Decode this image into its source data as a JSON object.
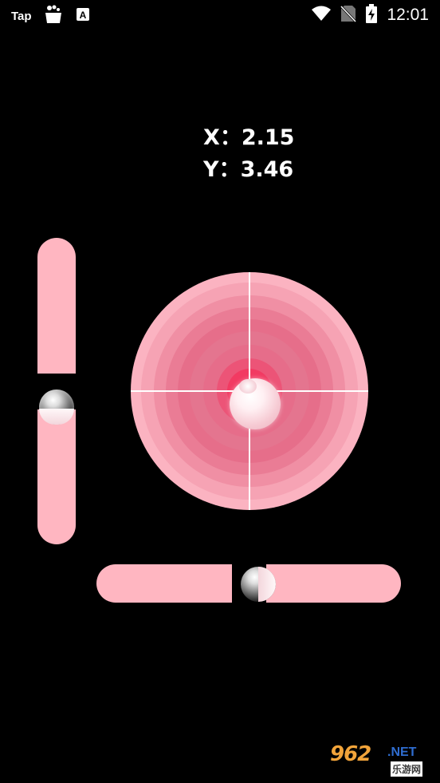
{
  "status_bar": {
    "app_label": "Tap",
    "time": "12:01",
    "icons": [
      "tap-app-icon",
      "bag-icon",
      "a-badge-icon",
      "wifi-icon",
      "no-sim-icon",
      "battery-charging-icon"
    ]
  },
  "readout": {
    "x_label": "X：",
    "x_value": "2.15",
    "y_label": "Y：",
    "y_value": "3.46"
  },
  "watermark": {
    "number": "962",
    "suffix": ".NET",
    "cn": "乐游网"
  },
  "colors": {
    "background": "#000000",
    "bar": "#ffb6c1",
    "ring_outer": "#f9a9b9",
    "ring_inner": "#f2385f",
    "crosshair": "#ffffff"
  }
}
